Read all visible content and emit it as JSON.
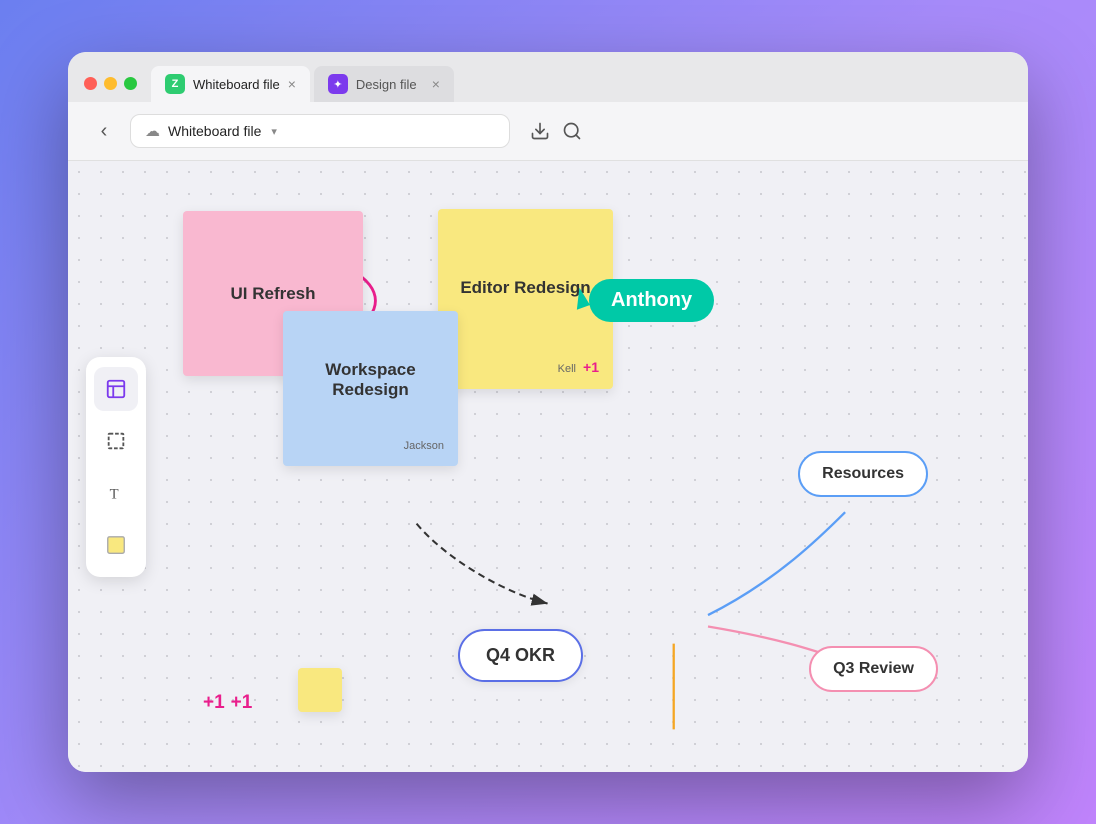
{
  "window": {
    "tabs": [
      {
        "id": "whiteboard",
        "label": "Whiteboard file",
        "icon_type": "whiteboard",
        "icon_symbol": "z",
        "active": true,
        "close": "×"
      },
      {
        "id": "design",
        "label": "Design file",
        "icon_type": "design",
        "icon_symbol": "✦",
        "active": false,
        "close": "×"
      }
    ]
  },
  "toolbar": {
    "back_icon": "‹",
    "cloud_icon": "☁",
    "file_label": "Whiteboard file",
    "chevron": "∨",
    "download_icon": "⬇",
    "search_icon": "🔍"
  },
  "tools": [
    {
      "id": "frame",
      "icon": "frame"
    },
    {
      "id": "crop",
      "icon": "crop"
    },
    {
      "id": "text",
      "icon": "text"
    },
    {
      "id": "sticky",
      "icon": "sticky"
    }
  ],
  "canvas": {
    "sticky_notes": [
      {
        "id": "pink",
        "color": "#f9b8d0",
        "text": "UI Refresh",
        "annotated": true
      },
      {
        "id": "yellow",
        "color": "#f9e87f",
        "text": "Editor Redesign",
        "author": "Kell"
      },
      {
        "id": "blue",
        "color": "#b8d4f5",
        "text": "Workspace Redesign",
        "author": "Jackson"
      }
    ],
    "cursor_user": "Anthony",
    "nodes": [
      {
        "id": "q4okr",
        "label": "Q4 OKR",
        "color": "#5b6fe6"
      },
      {
        "id": "resources",
        "label": "Resources",
        "color": "#5b9ef6"
      },
      {
        "id": "q3review",
        "label": "Q3 Review",
        "color": "#f48fb1"
      }
    ],
    "badges": [
      {
        "text": "+1",
        "location": "sticky-yellow"
      },
      {
        "text": "+1",
        "location": "bottom-left-1"
      },
      {
        "text": "+1",
        "location": "bottom-left-2"
      }
    ]
  }
}
